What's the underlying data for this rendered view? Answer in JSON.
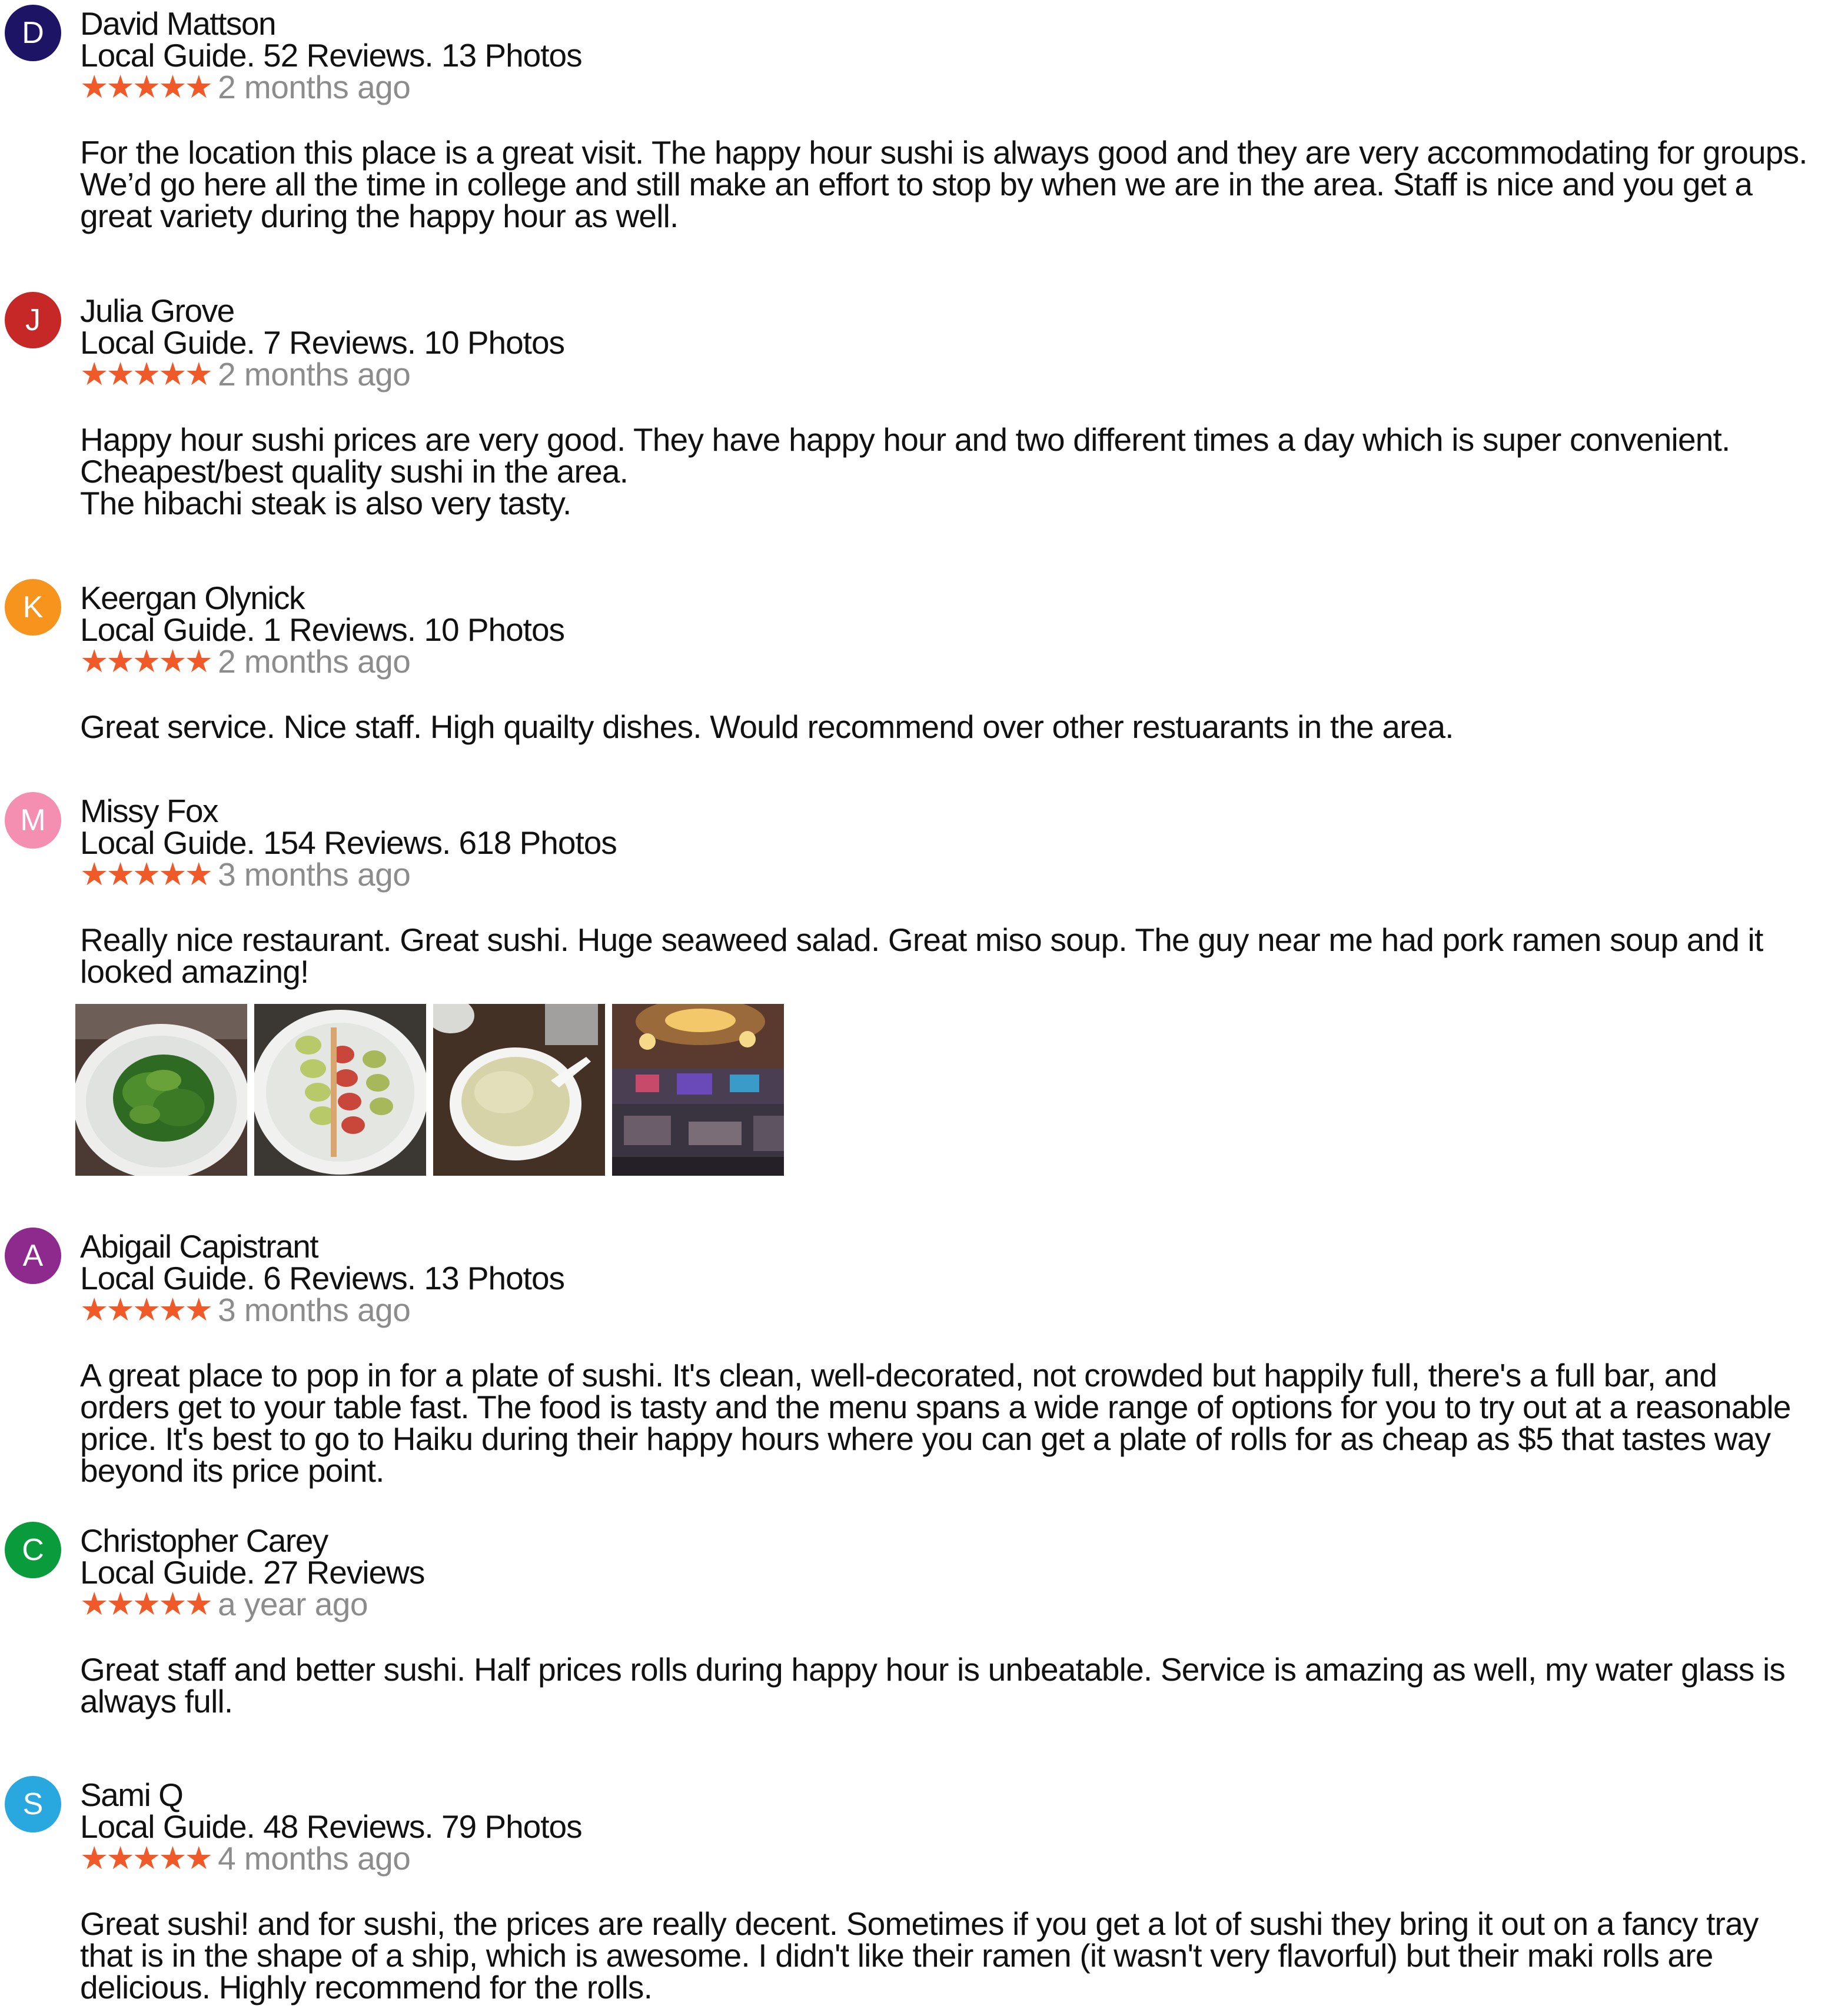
{
  "reviews": [
    {
      "initial": "D",
      "avatar_color": "#1e1466",
      "name": "David Mattson",
      "guide": "Local Guide. 52 Reviews. 13 Photos",
      "stars": "★★★★★",
      "rating": 5,
      "time": "2 months ago",
      "text": "For the location this place is a great visit. The happy hour sushi is always good and they are very accommodating for groups.\nWe’d go here all the time in college and still make an effort to stop by when we are in the area. Staff is nice and you get a\ngreat variety during the happy hour as well."
    },
    {
      "initial": "J",
      "avatar_color": "#c62828",
      "name": "Julia Grove",
      "guide": "Local Guide. 7 Reviews. 10 Photos",
      "stars": "★★★★★",
      "rating": 5,
      "time": "2 months ago",
      "text": "Happy hour sushi prices are very good. They have happy hour and two different times a day which is super convenient.\nCheapest/best quality sushi in the area.\nThe hibachi steak is also very tasty."
    },
    {
      "initial": "K",
      "avatar_color": "#f7941d",
      "name": "Keergan Olynick",
      "guide": "Local Guide. 1 Reviews. 10 Photos",
      "stars": "★★★★★",
      "rating": 5,
      "time": "2 months ago",
      "text": "Great service. Nice staff. High quailty dishes. Would recommend over other restuarants in the area."
    },
    {
      "initial": "M",
      "avatar_color": "#f48fb1",
      "name": "Missy Fox",
      "guide": "Local Guide. 154 Reviews. 618 Photos",
      "stars": "★★★★★",
      "rating": 5,
      "time": "3 months ago",
      "text": "Really nice restaurant. Great sushi. Huge seaweed salad. Great miso soup. The guy near me had pork ramen soup and it\nlooked amazing!"
    },
    {
      "initial": "A",
      "avatar_color": "#8e2a8e",
      "name": "Abigail Capistrant",
      "guide": "Local Guide. 6 Reviews. 13 Photos",
      "stars": "★★★★★",
      "rating": 5,
      "time": "3 months ago",
      "text": "A great place to pop in for a plate of sushi. It's clean, well-decorated, not crowded but happily full, there's a full bar, and\norders get to your table fast. The food is tasty and the menu spans a wide range of options for you to try out at a reasonable\nprice. It's best to go to Haiku during their happy hours where you can get a plate of rolls for as cheap as $5 that tastes way\nbeyond  its price point."
    },
    {
      "initial": "C",
      "avatar_color": "#0a9b3c",
      "name": "Christopher Carey",
      "guide": "Local Guide. 27 Reviews",
      "stars": "★★★★★",
      "rating": 5,
      "time": "a year ago",
      "text": "Great staff and better sushi. Half prices rolls during happy hour is unbeatable. Service is amazing as well, my water glass is\nalways full."
    },
    {
      "initial": "S",
      "avatar_color": "#29a8e0",
      "name": "Sami Q",
      "guide": "Local Guide. 48 Reviews. 79 Photos",
      "stars": "★★★★★",
      "rating": 5,
      "time": " 4 months ago",
      "text": "Great sushi! and for sushi, the prices are really decent. Sometimes if you get a lot of sushi they bring it out on a fancy tray\nthat is in the shape of a ship, which is awesome. I didn't like their ramen (it wasn't very flavorful) but their maki rolls are\ndelicious. Highly recommend for the rolls."
    }
  ]
}
